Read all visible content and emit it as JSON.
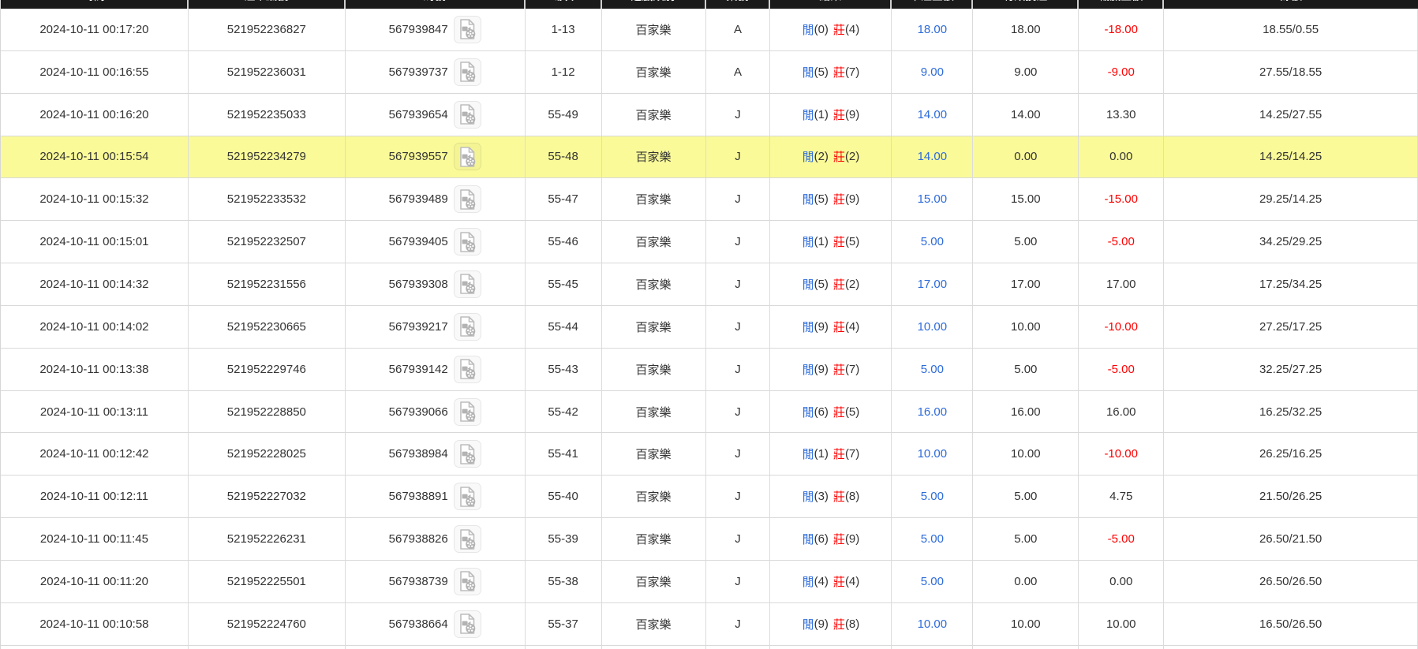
{
  "header": {
    "columns": [
      {
        "key": "time",
        "label": "時間"
      },
      {
        "key": "bet_no",
        "label": "注單編號"
      },
      {
        "key": "round_no",
        "label": "局號"
      },
      {
        "key": "session",
        "label": "場次"
      },
      {
        "key": "game_type",
        "label": "遊戲類別"
      },
      {
        "key": "table_code",
        "label": "桌號"
      },
      {
        "key": "result",
        "label": "結果"
      },
      {
        "key": "bet_amount",
        "label": "下注金額"
      },
      {
        "key": "valid_bet",
        "label": "有效投注"
      },
      {
        "key": "win_loss",
        "label": "輸贏金額"
      },
      {
        "key": "balance",
        "label": "餘額"
      }
    ]
  },
  "result_labels": {
    "player": "閒",
    "banker": "莊"
  },
  "icons": {
    "replay_icon": "video-file-with-film-reel"
  },
  "colors": {
    "header_bg": "#1b1b1b",
    "highlight_row": "#fafa99",
    "link_blue": "#2d6bdb",
    "negative_red": "#ff0000",
    "text": "#333333",
    "grid_line": "#d9d9d9"
  },
  "rows": [
    {
      "time": "2024-10-11 00:17:20",
      "bet_no": "521952236827",
      "round_no": "567939847",
      "session": "1-13",
      "game_type": "百家樂",
      "table_code": "A",
      "player_pts": "(0)",
      "banker_pts": "(4)",
      "bet_amount": "18.00",
      "valid_bet": "18.00",
      "win_loss": "-18.00",
      "balance": "18.55/0.55",
      "highlighted": false
    },
    {
      "time": "2024-10-11 00:16:55",
      "bet_no": "521952236031",
      "round_no": "567939737",
      "session": "1-12",
      "game_type": "百家樂",
      "table_code": "A",
      "player_pts": "(5)",
      "banker_pts": "(7)",
      "bet_amount": "9.00",
      "valid_bet": "9.00",
      "win_loss": "-9.00",
      "balance": "27.55/18.55",
      "highlighted": false
    },
    {
      "time": "2024-10-11 00:16:20",
      "bet_no": "521952235033",
      "round_no": "567939654",
      "session": "55-49",
      "game_type": "百家樂",
      "table_code": "J",
      "player_pts": "(1)",
      "banker_pts": "(9)",
      "bet_amount": "14.00",
      "valid_bet": "14.00",
      "win_loss": "13.30",
      "balance": "14.25/27.55",
      "highlighted": false
    },
    {
      "time": "2024-10-11 00:15:54",
      "bet_no": "521952234279",
      "round_no": "567939557",
      "session": "55-48",
      "game_type": "百家樂",
      "table_code": "J",
      "player_pts": "(2)",
      "banker_pts": "(2)",
      "bet_amount": "14.00",
      "valid_bet": "0.00",
      "win_loss": "0.00",
      "balance": "14.25/14.25",
      "highlighted": true
    },
    {
      "time": "2024-10-11 00:15:32",
      "bet_no": "521952233532",
      "round_no": "567939489",
      "session": "55-47",
      "game_type": "百家樂",
      "table_code": "J",
      "player_pts": "(5)",
      "banker_pts": "(9)",
      "bet_amount": "15.00",
      "valid_bet": "15.00",
      "win_loss": "-15.00",
      "balance": "29.25/14.25",
      "highlighted": false
    },
    {
      "time": "2024-10-11 00:15:01",
      "bet_no": "521952232507",
      "round_no": "567939405",
      "session": "55-46",
      "game_type": "百家樂",
      "table_code": "J",
      "player_pts": "(1)",
      "banker_pts": "(5)",
      "bet_amount": "5.00",
      "valid_bet": "5.00",
      "win_loss": "-5.00",
      "balance": "34.25/29.25",
      "highlighted": false
    },
    {
      "time": "2024-10-11 00:14:32",
      "bet_no": "521952231556",
      "round_no": "567939308",
      "session": "55-45",
      "game_type": "百家樂",
      "table_code": "J",
      "player_pts": "(5)",
      "banker_pts": "(2)",
      "bet_amount": "17.00",
      "valid_bet": "17.00",
      "win_loss": "17.00",
      "balance": "17.25/34.25",
      "highlighted": false
    },
    {
      "time": "2024-10-11 00:14:02",
      "bet_no": "521952230665",
      "round_no": "567939217",
      "session": "55-44",
      "game_type": "百家樂",
      "table_code": "J",
      "player_pts": "(9)",
      "banker_pts": "(4)",
      "bet_amount": "10.00",
      "valid_bet": "10.00",
      "win_loss": "-10.00",
      "balance": "27.25/17.25",
      "highlighted": false
    },
    {
      "time": "2024-10-11 00:13:38",
      "bet_no": "521952229746",
      "round_no": "567939142",
      "session": "55-43",
      "game_type": "百家樂",
      "table_code": "J",
      "player_pts": "(9)",
      "banker_pts": "(7)",
      "bet_amount": "5.00",
      "valid_bet": "5.00",
      "win_loss": "-5.00",
      "balance": "32.25/27.25",
      "highlighted": false
    },
    {
      "time": "2024-10-11 00:13:11",
      "bet_no": "521952228850",
      "round_no": "567939066",
      "session": "55-42",
      "game_type": "百家樂",
      "table_code": "J",
      "player_pts": "(6)",
      "banker_pts": "(5)",
      "bet_amount": "16.00",
      "valid_bet": "16.00",
      "win_loss": "16.00",
      "balance": "16.25/32.25",
      "highlighted": false
    },
    {
      "time": "2024-10-11 00:12:42",
      "bet_no": "521952228025",
      "round_no": "567938984",
      "session": "55-41",
      "game_type": "百家樂",
      "table_code": "J",
      "player_pts": "(1)",
      "banker_pts": "(7)",
      "bet_amount": "10.00",
      "valid_bet": "10.00",
      "win_loss": "-10.00",
      "balance": "26.25/16.25",
      "highlighted": false
    },
    {
      "time": "2024-10-11 00:12:11",
      "bet_no": "521952227032",
      "round_no": "567938891",
      "session": "55-40",
      "game_type": "百家樂",
      "table_code": "J",
      "player_pts": "(3)",
      "banker_pts": "(8)",
      "bet_amount": "5.00",
      "valid_bet": "5.00",
      "win_loss": "4.75",
      "balance": "21.50/26.25",
      "highlighted": false
    },
    {
      "time": "2024-10-11 00:11:45",
      "bet_no": "521952226231",
      "round_no": "567938826",
      "session": "55-39",
      "game_type": "百家樂",
      "table_code": "J",
      "player_pts": "(6)",
      "banker_pts": "(9)",
      "bet_amount": "5.00",
      "valid_bet": "5.00",
      "win_loss": "-5.00",
      "balance": "26.50/21.50",
      "highlighted": false
    },
    {
      "time": "2024-10-11 00:11:20",
      "bet_no": "521952225501",
      "round_no": "567938739",
      "session": "55-38",
      "game_type": "百家樂",
      "table_code": "J",
      "player_pts": "(4)",
      "banker_pts": "(4)",
      "bet_amount": "5.00",
      "valid_bet": "0.00",
      "win_loss": "0.00",
      "balance": "26.50/26.50",
      "highlighted": false
    },
    {
      "time": "2024-10-11 00:10:58",
      "bet_no": "521952224760",
      "round_no": "567938664",
      "session": "55-37",
      "game_type": "百家樂",
      "table_code": "J",
      "player_pts": "(9)",
      "banker_pts": "(8)",
      "bet_amount": "10.00",
      "valid_bet": "10.00",
      "win_loss": "10.00",
      "balance": "16.50/26.50",
      "highlighted": false
    }
  ]
}
